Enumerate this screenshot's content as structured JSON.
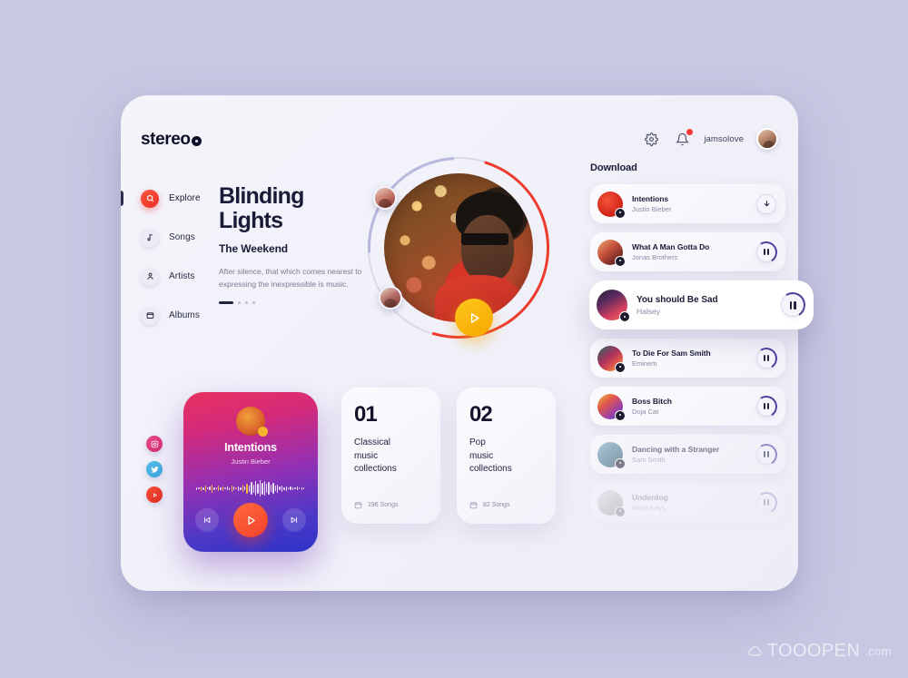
{
  "app": {
    "logo_text": "stereo",
    "background_color": "#c9c8e3",
    "accent_red": "#ee3b2e",
    "accent_yellow": "#f5a800",
    "accent_purple": "#4b3f9e"
  },
  "header": {
    "settings_icon": "gear-icon",
    "notifications_icon": "bell-icon",
    "notification_badge": true,
    "username": "jamsolove",
    "avatar": "user-avatar"
  },
  "sidebar": {
    "items": [
      {
        "label": "Explore",
        "icon": "search-icon",
        "active": true
      },
      {
        "label": "Songs",
        "icon": "music-note-icon",
        "active": false
      },
      {
        "label": "Artists",
        "icon": "artist-icon",
        "active": false
      },
      {
        "label": "Albums",
        "icon": "album-icon",
        "active": false
      }
    ]
  },
  "hero": {
    "title_line1": "Blinding",
    "title_line2": "Lights",
    "artist": "The Weekend",
    "description": "After silence, that which comes nearest to expressing the inexpressible is music.",
    "play_icon": "play-icon",
    "pagination_active": 1,
    "pagination_total": 4
  },
  "download": {
    "title": "Download",
    "items": [
      {
        "song": "Intentions",
        "artist": "Justin Bieber",
        "action": "download-icon",
        "state": "normal"
      },
      {
        "song": "What A Man Gotta Do",
        "artist": "Jonas Brothers",
        "action": "pause-icon",
        "state": "normal"
      },
      {
        "song": "You should Be Sad",
        "artist": "Halsey",
        "action": "pause-icon",
        "state": "active"
      },
      {
        "song": "To Die For Sam Smith",
        "artist": "Eminem",
        "action": "pause-icon",
        "state": "normal"
      },
      {
        "song": "Boss Bitch",
        "artist": "Doja Cat",
        "action": "pause-icon",
        "state": "normal"
      },
      {
        "song": "Dancing with a Stranger",
        "artist": "Sam Smith",
        "action": "pause-icon",
        "state": "dim-1"
      },
      {
        "song": "Underdog",
        "artist": "Alicia Keys",
        "action": "pause-icon",
        "state": "dim-2"
      }
    ]
  },
  "now_playing": {
    "title": "Intentions",
    "artist": "Justin Bieber",
    "prev_icon": "skip-previous-icon",
    "play_icon": "play-icon",
    "next_icon": "skip-next-icon"
  },
  "social": [
    {
      "name": "instagram-icon"
    },
    {
      "name": "twitter-icon"
    },
    {
      "name": "youtube-icon"
    }
  ],
  "collections": [
    {
      "number": "01",
      "line1": "Classical",
      "line2": "music",
      "line3": "collections",
      "count": "196 Songs"
    },
    {
      "number": "02",
      "line1": "Pop",
      "line2": "music",
      "line3": "collections",
      "count": "82 Songs"
    }
  ],
  "watermark": {
    "main": "TOOOPEN",
    "suffix": ".com",
    "icon": "cloud-icon"
  }
}
